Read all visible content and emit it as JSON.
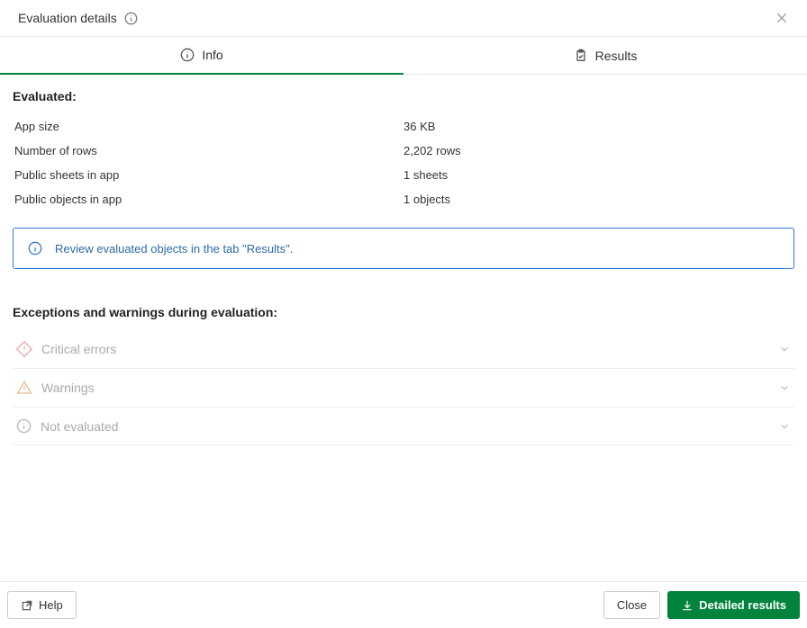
{
  "header": {
    "title": "Evaluation details"
  },
  "tabs": {
    "info": "Info",
    "results": "Results"
  },
  "evaluated": {
    "heading": "Evaluated:",
    "rows": [
      {
        "key": "App size",
        "val": "36 KB"
      },
      {
        "key": "Number of rows",
        "val": "2,202 rows"
      },
      {
        "key": "Public sheets in app",
        "val": "1 sheets"
      },
      {
        "key": "Public objects in app",
        "val": "1 objects"
      }
    ]
  },
  "infobox": {
    "text": "Review evaluated objects in the tab \"Results\"."
  },
  "exceptions": {
    "heading": "Exceptions and warnings during evaluation:",
    "items": {
      "critical": "Critical errors",
      "warnings": "Warnings",
      "not_evaluated": "Not evaluated"
    }
  },
  "footer": {
    "help": "Help",
    "close": "Close",
    "detailed": "Detailed results"
  }
}
